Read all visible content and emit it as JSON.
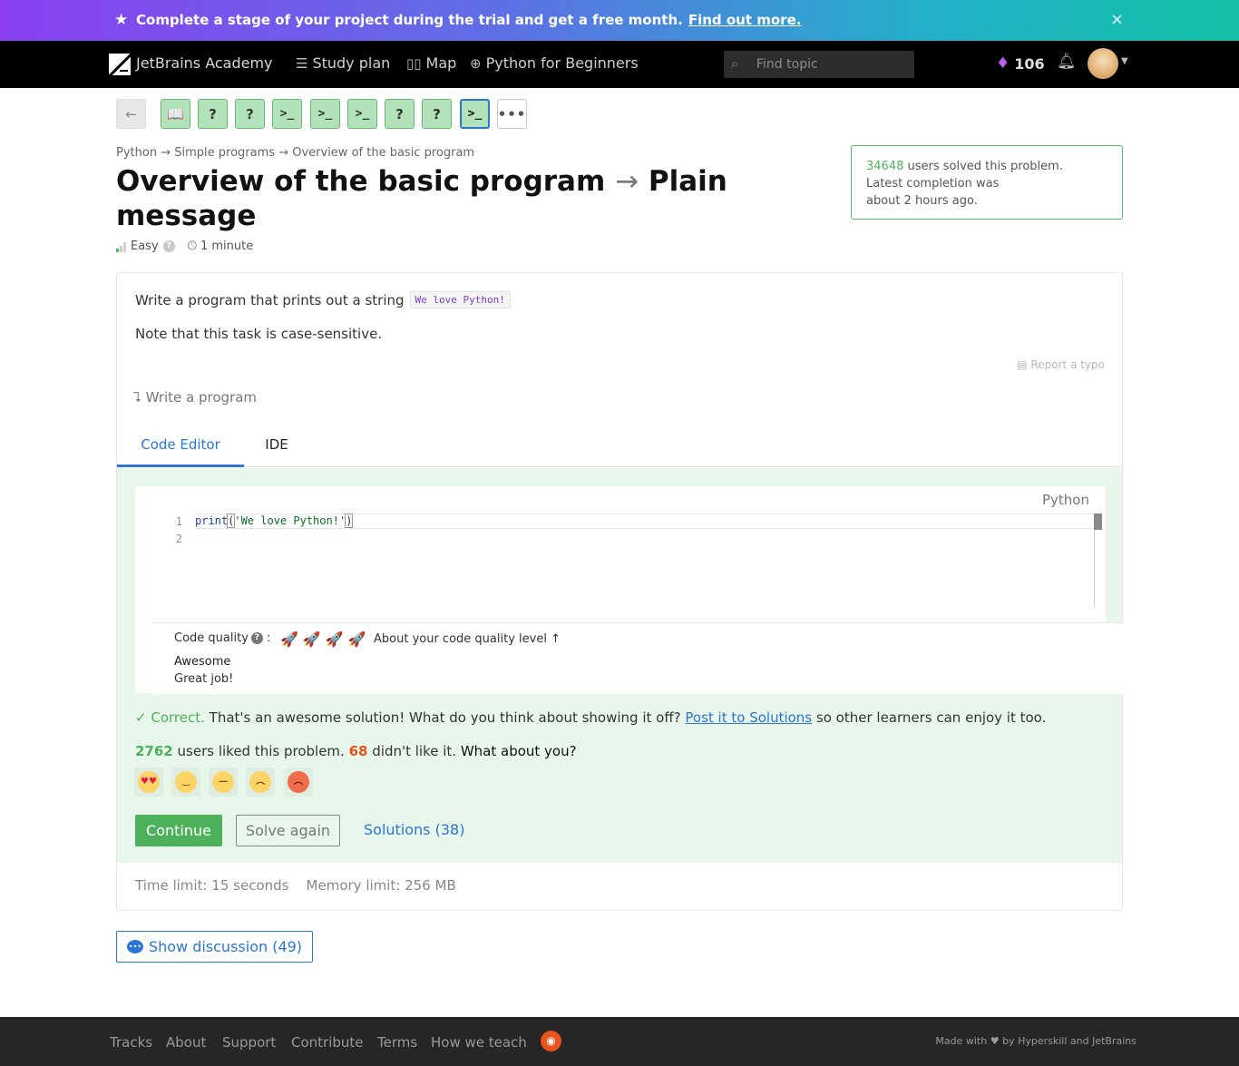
{
  "banner": {
    "message": "Complete a stage of your project during the trial and get a free month.",
    "link": "Find out more.",
    "close": "×"
  },
  "header": {
    "logo": "JetBrains Academy",
    "nav": [
      "Study plan",
      "Map",
      "Python for Beginners"
    ],
    "search_placeholder": "Find topic",
    "gems": "106"
  },
  "steps": {
    "back": "←",
    "items": [
      "📖",
      "?",
      "?",
      ">_",
      ">_",
      ">_",
      "?",
      "?",
      ">_"
    ],
    "more": "•••"
  },
  "breadcrumb": [
    "Python",
    "Simple programs",
    "Overview of the basic program"
  ],
  "breadcrumb_sep": "→",
  "title": {
    "part1": "Overview of the basic program",
    "arrow": "→",
    "part2": "Plain message"
  },
  "meta": {
    "difficulty": "Easy",
    "time": "1 minute"
  },
  "solved": {
    "count": "34648",
    "text": "users solved this problem.",
    "line2": "Latest completion was",
    "line3": "about 2 hours ago."
  },
  "task": {
    "text": "Write a program that prints out a string",
    "code": "We love Python!",
    "note": "Note that this task is case-sensitive.",
    "report": "Report a typo",
    "write": "Write a program"
  },
  "tabs": [
    "Code Editor",
    "IDE"
  ],
  "editor": {
    "language": "Python",
    "line_numbers": [
      "1",
      "2"
    ],
    "code_func": "print",
    "code_open": "(",
    "code_string": "'We love Python!'",
    "code_close": ")"
  },
  "quality": {
    "label": "Code quality",
    "about": "About your code quality level ↑",
    "level": "Awesome",
    "sub": "Great job!",
    "rockets": "🚀🚀🚀🚀"
  },
  "result": {
    "correct": "Correct.",
    "message": "That's an awesome solution! What do you think about showing it off?",
    "link": "Post it to Solutions",
    "tail": "so other learners can enjoy it too."
  },
  "likes": {
    "liked": "2762",
    "liked_text": "users liked this problem.",
    "disliked": "68",
    "disliked_text": "didn't like it.",
    "question": "What about you?"
  },
  "actions": {
    "continue": "Continue",
    "solve_again": "Solve again",
    "solutions": "Solutions (38)"
  },
  "limits": {
    "time": "Time limit: 15 seconds",
    "memory": "Memory limit: 256 MB"
  },
  "discussion": "Show discussion (49)",
  "footer": {
    "links": [
      "Tracks",
      "About",
      "Support",
      "Contribute",
      "Terms",
      "How we teach"
    ],
    "made_pre": "Made with",
    "made_post": "by Hyperskill and JetBrains"
  },
  "colors": {
    "accent": "#2a76d2",
    "success": "#4db15b",
    "danger": "#e8531f"
  }
}
